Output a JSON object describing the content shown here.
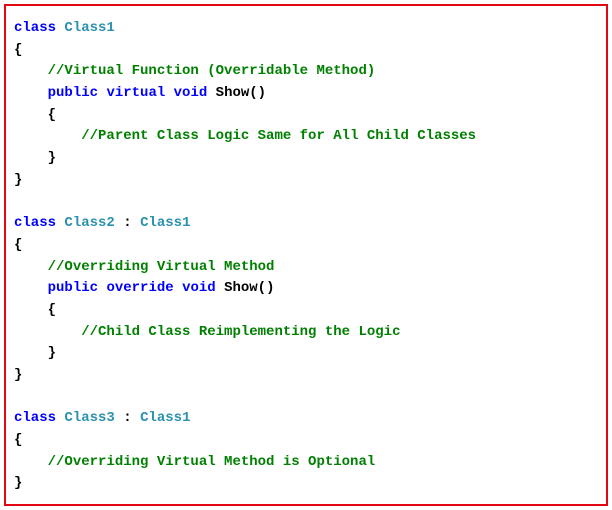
{
  "code": {
    "class1": {
      "kw_class": "class",
      "name": "Class1",
      "brace_open": "{",
      "comment_virtual": "//Virtual Function (Overridable Method)",
      "kw_public": "public",
      "kw_virtual": "virtual",
      "kw_void": "void",
      "method_name": "Show()",
      "method_brace_open": "{",
      "comment_logic": "//Parent Class Logic Same for All Child Classes",
      "method_brace_close": "}",
      "brace_close": "}"
    },
    "class2": {
      "kw_class": "class",
      "name": "Class2",
      "inherit_sep": " : ",
      "base": "Class1",
      "brace_open": "{",
      "comment_override": "//Overriding Virtual Method",
      "kw_public": "public",
      "kw_override": "override",
      "kw_void": "void",
      "method_name": "Show()",
      "method_brace_open": "{",
      "comment_logic": "//Child Class Reimplementing the Logic",
      "method_brace_close": "}",
      "brace_close": "}"
    },
    "class3": {
      "kw_class": "class",
      "name": "Class3",
      "inherit_sep": " : ",
      "base": "Class1",
      "brace_open": "{",
      "comment_optional": "//Overriding Virtual Method is Optional",
      "brace_close": "}"
    }
  }
}
